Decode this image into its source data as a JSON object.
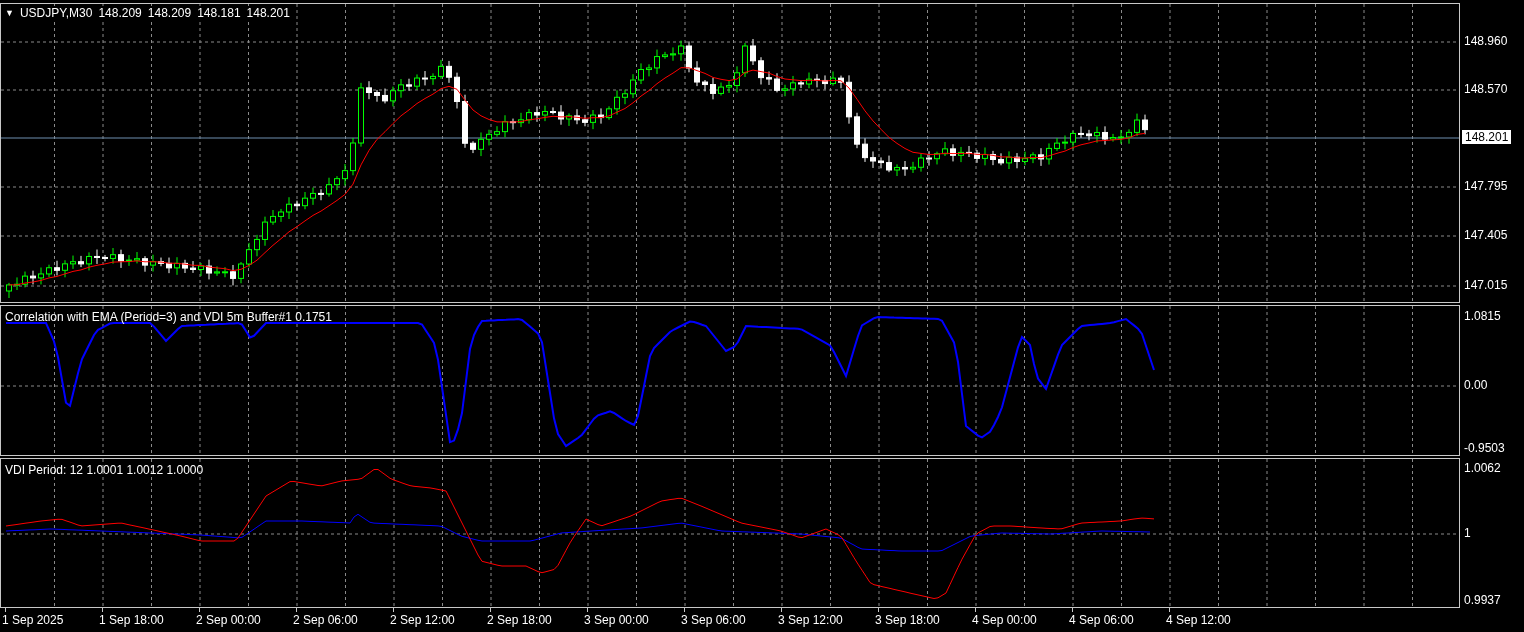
{
  "chart": {
    "menu_glyph": "▼",
    "symbol_caption": "USDJPY,M30",
    "ohlc": [
      "148.209",
      "148.209",
      "148.181",
      "148.201"
    ],
    "price_axis": [
      "148.960",
      "148.570",
      "147.795",
      "147.405",
      "147.015"
    ],
    "current_price": "148.201"
  },
  "indicators": [
    {
      "caption": "Correlation with EMA (Period=3) and VDI 5m Buffer#1 0.1751",
      "axis": [
        "1.0815",
        "0.00",
        "-0.9503"
      ]
    },
    {
      "caption": "VDI Period: 12 1.0001 1.0012 1.0000",
      "axis": [
        "1.0062",
        "1",
        "0.9937"
      ]
    }
  ],
  "time_axis": [
    "1 Sep 2025",
    "1 Sep 18:00",
    "2 Sep 00:00",
    "2 Sep 06:00",
    "2 Sep 12:00",
    "2 Sep 18:00",
    "3 Sep 00:00",
    "3 Sep 06:00",
    "3 Sep 12:00",
    "3 Sep 18:00",
    "4 Sep 00:00",
    "4 Sep 06:00",
    "4 Sep 12:00"
  ]
}
